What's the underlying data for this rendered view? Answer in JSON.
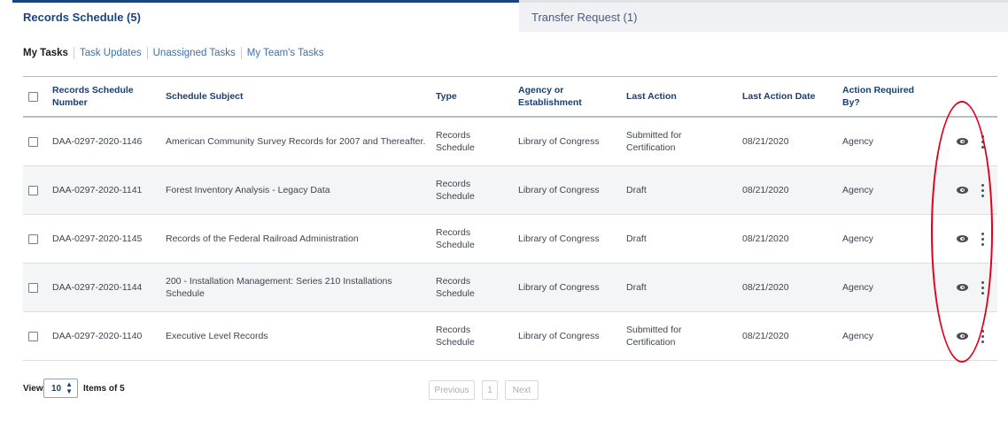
{
  "tabs": [
    {
      "label": "Records Schedule (5)",
      "active": true
    },
    {
      "label": "Transfer Request (1)",
      "active": false
    }
  ],
  "subnav": [
    "My Tasks",
    "Task Updates",
    "Unassigned Tasks",
    "My Team's Tasks"
  ],
  "table": {
    "headers": {
      "number": "Records Schedule Number",
      "subject": "Schedule Subject",
      "type": "Type",
      "agency": "Agency or Establishment",
      "last_action": "Last Action",
      "last_action_date": "Last Action Date",
      "action_required_by": "Action Required By?"
    },
    "rows": [
      {
        "number": "DAA-0297-2020-1146",
        "subject": "American Community Survey Records for 2007 and Thereafter.",
        "type": "Records Schedule",
        "agency": "Library of Congress",
        "last_action": "Submitted for Certification",
        "date": "08/21/2020",
        "required_by": "Agency"
      },
      {
        "number": "DAA-0297-2020-1141",
        "subject": "Forest Inventory Analysis - Legacy Data",
        "type": "Records Schedule",
        "agency": "Library of Congress",
        "last_action": "Draft",
        "date": "08/21/2020",
        "required_by": "Agency"
      },
      {
        "number": "DAA-0297-2020-1145",
        "subject": "Records of the Federal Railroad Administration",
        "type": "Records Schedule",
        "agency": "Library of Congress",
        "last_action": "Draft",
        "date": "08/21/2020",
        "required_by": "Agency"
      },
      {
        "number": "DAA-0297-2020-1144",
        "subject": "200 - Installation Management: Series 210 Installations Schedule",
        "type": "Records Schedule",
        "agency": "Library of Congress",
        "last_action": "Draft",
        "date": "08/21/2020",
        "required_by": "Agency"
      },
      {
        "number": "DAA-0297-2020-1140",
        "subject": "Executive Level Records",
        "type": "Records Schedule",
        "agency": "Library of Congress",
        "last_action": "Submitted for Certification",
        "date": "08/21/2020",
        "required_by": "Agency"
      }
    ]
  },
  "footer": {
    "view_label": "View",
    "page_size": "10",
    "items_of": "Items of 5",
    "previous": "Previous",
    "page": "1",
    "next": "Next"
  },
  "colors": {
    "accent": "#1a4480",
    "annotation": "#e0001b"
  }
}
